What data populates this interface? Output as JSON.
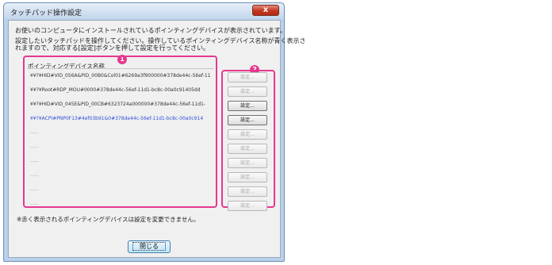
{
  "window": {
    "title": "タッチパッド操作設定",
    "close_glyph": "x"
  },
  "messages": {
    "line1": "お使いのコンピュータにインストールされているポインティングデバイスが表示されています。",
    "line2": "設定したいタッチパッドを操作してください。操作しているポインティングデバイス名称が青く表示さ",
    "line3": "れますので、対応する[設定]ボタンを押して設定を行ってください。"
  },
  "device_list": {
    "header": "ポインティングデバイス名称",
    "rows": [
      {
        "text": "¥¥?¥HID#VID_056A&PID_00B0&Col01#6269a3f900000#378de44c-56ef-11",
        "highlight": false
      },
      {
        "text": "¥¥?¥Root#RDP_MOU#0000#378de44c-56ef-11d1-bc8c-00a0c91405dd",
        "highlight": false
      },
      {
        "text": "¥¥?¥HID#VID_045E&PID_00CB#6323724a000000#378de44c-56ef-11d1-",
        "highlight": false
      },
      {
        "text": "¥¥?¥ACPI#PNP0F13#4ef03b91&0#378de44c-56ef-11d1-bc8c-00a0c914",
        "highlight": true
      },
      {
        "text": "-----",
        "highlight": false
      },
      {
        "text": "-----",
        "highlight": false
      },
      {
        "text": "-----",
        "highlight": false
      },
      {
        "text": "-----",
        "highlight": false
      },
      {
        "text": "-----",
        "highlight": false
      },
      {
        "text": "-----",
        "highlight": false
      }
    ]
  },
  "settings_buttons": [
    {
      "label": "設定...",
      "enabled": false
    },
    {
      "label": "設定...",
      "enabled": false
    },
    {
      "label": "設定...",
      "enabled": true
    },
    {
      "label": "設定...",
      "enabled": true
    },
    {
      "label": "設定...",
      "enabled": false
    },
    {
      "label": "設定...",
      "enabled": false
    },
    {
      "label": "設定...",
      "enabled": false
    },
    {
      "label": "設定...",
      "enabled": false
    },
    {
      "label": "設定...",
      "enabled": false
    },
    {
      "label": "設定...",
      "enabled": false
    }
  ],
  "annotations": {
    "badge1": "1",
    "badge2": "2"
  },
  "note": "※赤く表示されるポインティングデバイスは設定を変更できません。",
  "footer": {
    "close_label": "閉じる"
  },
  "colors": {
    "highlight_text": "#2f4fd8",
    "annotation": "#e6388f"
  }
}
